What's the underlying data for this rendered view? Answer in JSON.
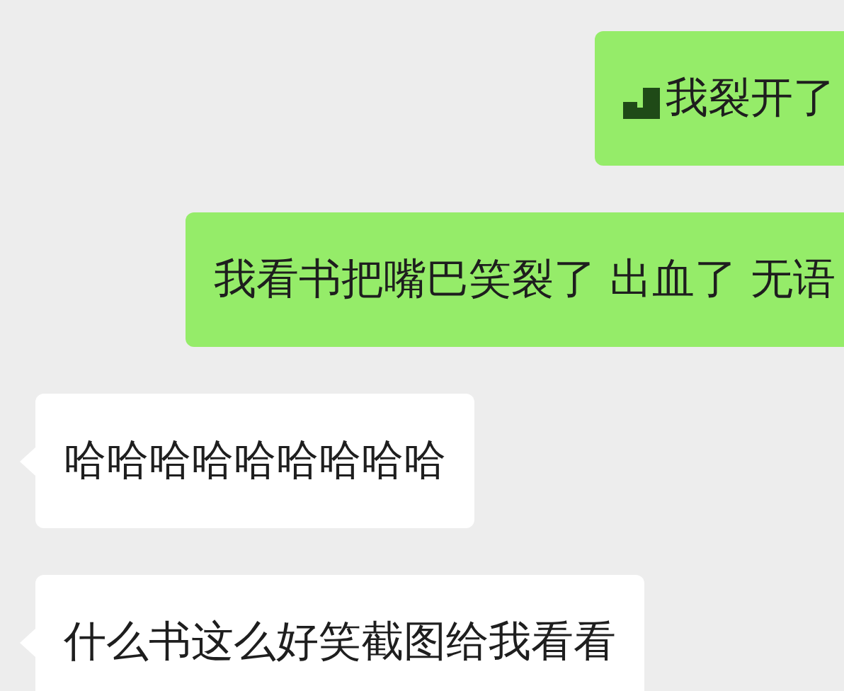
{
  "messages": [
    {
      "kind": "sent",
      "icon": true,
      "text": "我裂开了"
    },
    {
      "kind": "sent",
      "icon": false,
      "text": "我看书把嘴巴笑裂了 出血了 无语"
    },
    {
      "kind": "received",
      "icon": false,
      "text": "哈哈哈哈哈哈哈哈哈"
    },
    {
      "kind": "received",
      "icon": false,
      "text": "什么书这么好笑截图给我看看"
    }
  ]
}
